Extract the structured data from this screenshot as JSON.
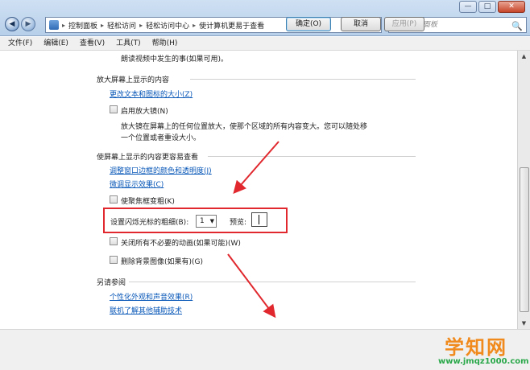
{
  "window": {
    "min_label": "—",
    "max_label": "□",
    "close_label": "✕"
  },
  "nav": {
    "back": "◀",
    "forward": "▶",
    "recent": "▾"
  },
  "address": {
    "crumbs": [
      "控制面板",
      "轻松访问",
      "轻松访问中心",
      "使计算机更易于查看"
    ],
    "separator": "▸",
    "dropdown": "▾",
    "refresh": "⟳"
  },
  "search": {
    "placeholder": "搜索控制面板",
    "icon": "🔍"
  },
  "menu": [
    "文件(F)",
    "编辑(E)",
    "查看(V)",
    "工具(T)",
    "帮助(H)"
  ],
  "content": {
    "narrator_desc": "朗读视频中发生的事(如果可用)。",
    "section_magnify": {
      "heading": "放大屏幕上显示的内容",
      "link_text_size": "更改文本和图标的大小(Z)",
      "magnifier_label": "启用放大镜(N)",
      "magnifier_desc_line1": "放大镜在屏幕上的任何位置放大，使那个区域的所有内容变大。您可以随处移",
      "magnifier_desc_line2": "一个位置或者重设大小。"
    },
    "section_easier": {
      "heading": "使屏幕上显示的内容更容易查看",
      "link_window_color": "调整窗口边框的颜色和透明度(J)",
      "link_display_effects": "微调显示效果(C)",
      "focus_rect_label": "使聚焦框变粗(K)",
      "cursor_thickness_label": "设置闪烁光标的粗细(B):",
      "cursor_thickness_value": "1",
      "preview_label": "预览:",
      "animations_label": "关闭所有不必要的动画(如果可能)(W)",
      "background_label": "删除背景图像(如果有)(G)"
    },
    "see_also": {
      "heading": "另请参阅",
      "link_personalize": "个性化外观和声音效果(R)",
      "link_assistive": "联机了解其他辅助技术"
    }
  },
  "buttons": {
    "ok": "确定(O)",
    "cancel": "取消",
    "apply": "应用(P)"
  },
  "watermark": {
    "title": "学知网",
    "url": "www.jmqz1000.com"
  },
  "annotations": {
    "highlight_color": "#e0282e"
  }
}
